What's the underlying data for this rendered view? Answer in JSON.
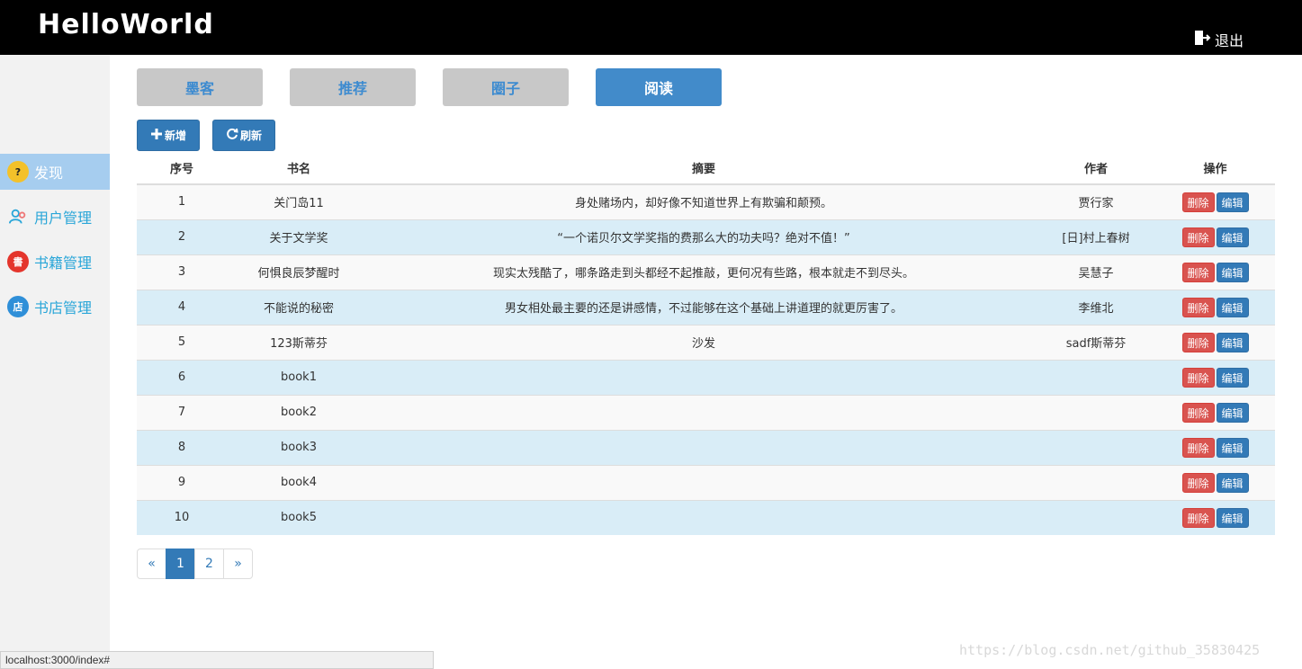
{
  "header": {
    "logo": "HelloWorld",
    "logout_label": "退出"
  },
  "sidebar": {
    "items": [
      {
        "label": "发现",
        "icon": "compass-icon",
        "active": true
      },
      {
        "label": "用户管理",
        "icon": "users-icon",
        "active": false
      },
      {
        "label": "书籍管理",
        "icon": "book-icon",
        "active": false
      },
      {
        "label": "书店管理",
        "icon": "store-icon",
        "active": false
      }
    ]
  },
  "tabs": [
    {
      "label": "墨客",
      "active": false
    },
    {
      "label": "推荐",
      "active": false
    },
    {
      "label": "圈子",
      "active": false
    },
    {
      "label": "阅读",
      "active": true
    }
  ],
  "toolbar": {
    "add_label": "新增",
    "refresh_label": "刷新"
  },
  "table": {
    "headers": [
      "序号",
      "书名",
      "摘要",
      "作者",
      "操作"
    ],
    "delete_label": "删除",
    "edit_label": "编辑",
    "rows": [
      {
        "no": "1",
        "title": "关门岛11",
        "summary": "身处赌场内，却好像不知道世界上有欺骗和颠预。",
        "author": "贾行家"
      },
      {
        "no": "2",
        "title": "关于文学奖",
        "summary": "“一个诺贝尔文学奖指的费那么大的功夫吗？绝对不值！”",
        "author": "[日]村上春树"
      },
      {
        "no": "3",
        "title": "何惧良辰梦醒时",
        "summary": "现实太残酷了，哪条路走到头都经不起推敲，更何况有些路，根本就走不到尽头。",
        "author": "吴慧子"
      },
      {
        "no": "4",
        "title": "不能说的秘密",
        "summary": "男女相处最主要的还是讲感情，不过能够在这个基础上讲道理的就更厉害了。",
        "author": "李维北"
      },
      {
        "no": "5",
        "title": "123斯蒂芬",
        "summary": "沙发",
        "author": "sadf斯蒂芬"
      },
      {
        "no": "6",
        "title": "book1",
        "summary": "",
        "author": ""
      },
      {
        "no": "7",
        "title": "book2",
        "summary": "",
        "author": ""
      },
      {
        "no": "8",
        "title": "book3",
        "summary": "",
        "author": ""
      },
      {
        "no": "9",
        "title": "book4",
        "summary": "",
        "author": ""
      },
      {
        "no": "10",
        "title": "book5",
        "summary": "",
        "author": ""
      }
    ]
  },
  "pagination": {
    "prev": "«",
    "pages": [
      "1",
      "2"
    ],
    "current": "1",
    "next": "»"
  },
  "status_bar": "localhost:3000/index#",
  "watermark": "https://blog.csdn.net/github_35830425",
  "colors": {
    "primary": "#337ab7",
    "danger": "#d9534f",
    "sidebar_active": "#a6cdef",
    "stripe": "#d9edf7"
  }
}
